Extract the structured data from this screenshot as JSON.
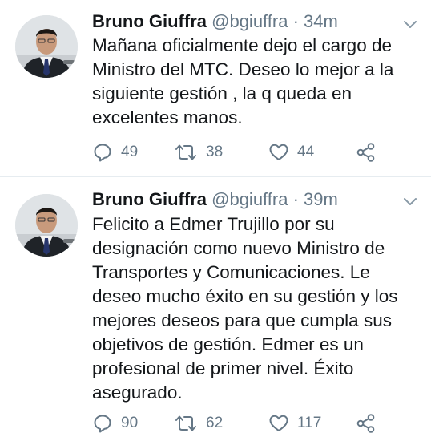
{
  "tweets": [
    {
      "name": "Bruno Giuffra",
      "handle": "@bgiuffra",
      "separator": "·",
      "time": "34m",
      "lines": [
        "Mañana oficialmente dejo el cargo de",
        "Ministro del MTC. Deseo lo mejor a la",
        "siguiente gestión , la q queda en",
        "excelentes manos."
      ],
      "replies": "49",
      "retweets": "38",
      "likes": "44"
    },
    {
      "name": "Bruno Giuffra",
      "handle": "@bgiuffra",
      "separator": "·",
      "time": "39m",
      "lines": [
        "Felicito a Edmer Trujillo por su",
        "designación como nuevo Ministro de",
        "Transportes y Comunicaciones. Le",
        "deseo mucho éxito en su gestión y los",
        "mejores deseos para que cumpla sus",
        "objetivos de gestión. Edmer es un",
        "profesional de primer nivel. Éxito",
        "asegurado."
      ],
      "replies": "90",
      "retweets": "62",
      "likes": "117"
    }
  ],
  "icons": {
    "caret": "chevron-down-icon",
    "reply": "reply-icon",
    "retweet": "retweet-icon",
    "like": "heart-icon",
    "share": "share-icon"
  },
  "colors": {
    "text": "#14171a",
    "secondary": "#657786",
    "icon": "#657786",
    "divider": "#e6ecf0"
  }
}
